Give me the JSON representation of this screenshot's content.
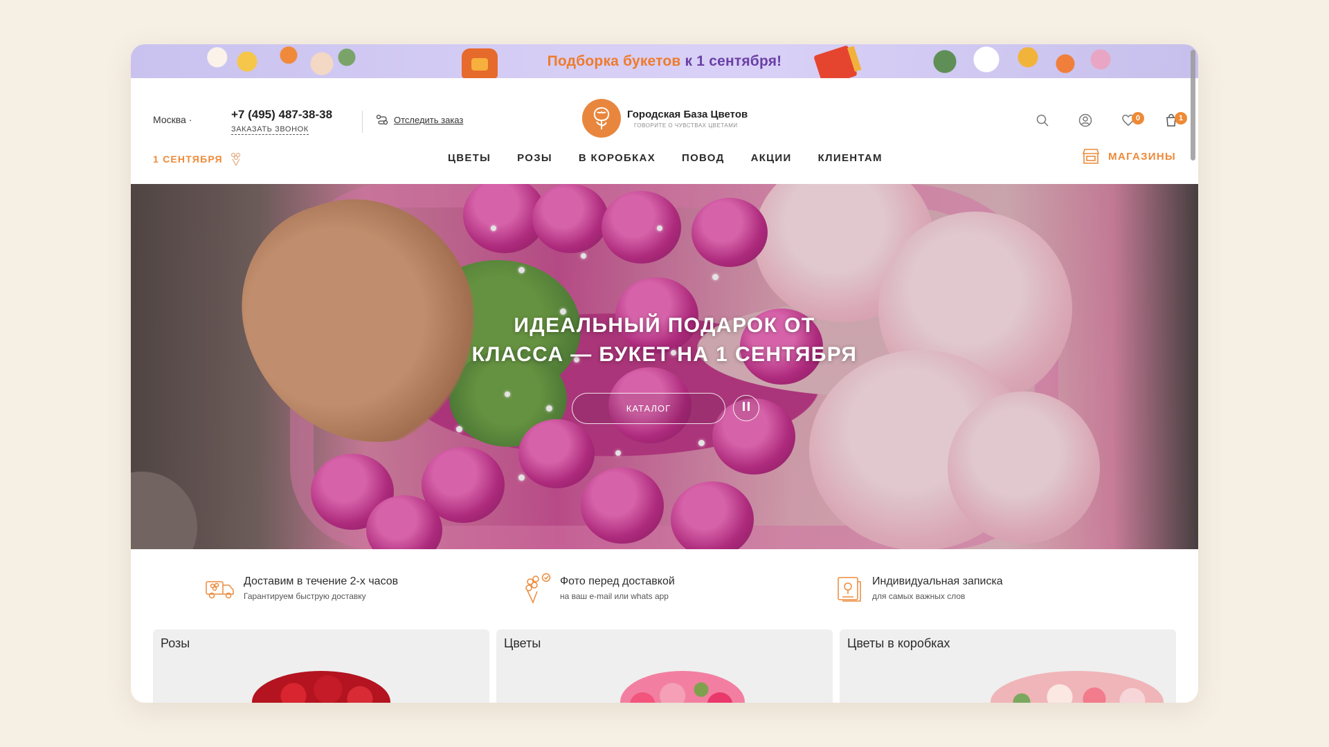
{
  "colors": {
    "accent": "#ec8a3a",
    "badge": "#ee8a35",
    "promo_purple": "#6a3fa7",
    "promo_orange": "#ee7b2c"
  },
  "promo": {
    "part1": "Подборка букетов",
    "part2": "к 1 сентября!"
  },
  "header": {
    "city": "Москва",
    "phone": "+7 (495) 487-38-38",
    "callback": "ЗАКАЗАТЬ ЗВОНОК",
    "track_order": "Отследить заказ",
    "logo_name": "Городская База Цветов",
    "logo_tagline": "ГОВОРИТЕ О ЧУВСТВАХ ЦВЕТАМИ",
    "favorites_count": "0",
    "cart_count": "1",
    "icons": [
      "search-icon",
      "user-icon",
      "heart-icon",
      "bag-icon"
    ]
  },
  "nav": {
    "promo_label": "1 СЕНТЯБРЯ",
    "items": [
      "ЦВЕТЫ",
      "РОЗЫ",
      "В КОРОБКАХ",
      "ПОВОД",
      "АКЦИИ",
      "КЛИЕНТАМ"
    ],
    "stores": "МАГАЗИНЫ"
  },
  "hero": {
    "title_line1": "ИДЕАЛЬНЫЙ ПОДАРОК ОТ",
    "title_line2": "КЛАССА — БУКЕТ НА 1 СЕНТЯБРЯ",
    "catalog_button": "КАТАЛОГ"
  },
  "features": [
    {
      "title": "Доставим в течение 2-х часов",
      "subtitle": "Гарантируем быструю доставку",
      "icon": "delivery-truck-icon"
    },
    {
      "title": "Фото перед доставкой",
      "subtitle": "на ваш e-mail или whats app",
      "icon": "bouquet-photo-icon"
    },
    {
      "title": "Индивидуальная записка",
      "subtitle": "для самых важных слов",
      "icon": "note-card-icon"
    }
  ],
  "categories": [
    {
      "title": "Розы"
    },
    {
      "title": "Цветы"
    },
    {
      "title": "Цветы в коробках"
    }
  ]
}
